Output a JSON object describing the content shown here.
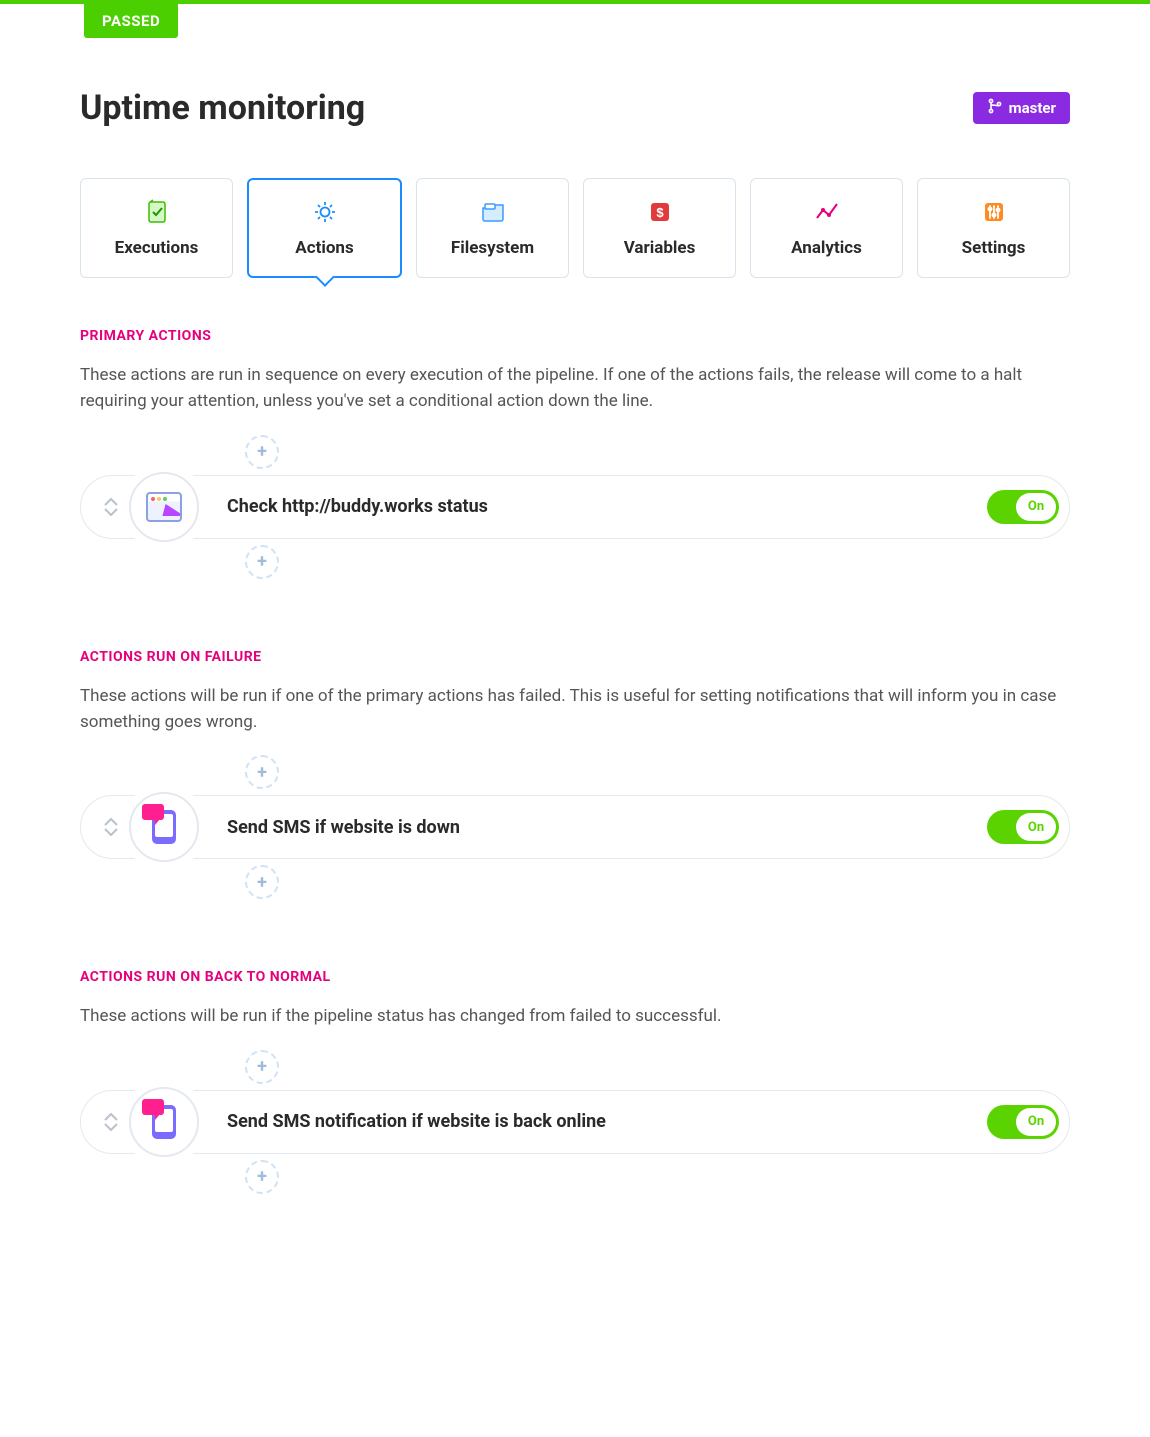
{
  "status_badge": "PASSED",
  "page_title": "Uptime monitoring",
  "branch_label": "master",
  "tabs": [
    {
      "label": "Executions"
    },
    {
      "label": "Actions"
    },
    {
      "label": "Filesystem"
    },
    {
      "label": "Variables"
    },
    {
      "label": "Analytics"
    },
    {
      "label": "Settings"
    }
  ],
  "active_tab_index": 1,
  "sections": {
    "primary": {
      "heading": "PRIMARY ACTIONS",
      "desc": "These actions are run in sequence on every execution of the pipeline. If one of the actions fails, the release will come to a halt requiring your attention, unless you've set a conditional action down the line.",
      "action": {
        "title": "Check http://buddy.works status",
        "toggle": "On"
      }
    },
    "failure": {
      "heading": "ACTIONS RUN ON FAILURE",
      "desc": "These actions will be run if one of the primary actions has failed. This is useful for setting notifications that will inform you in case something goes wrong.",
      "action": {
        "title": "Send SMS if website is down",
        "toggle": "On"
      }
    },
    "backnormal": {
      "heading": "ACTIONS RUN ON BACK TO NORMAL",
      "desc": "These actions will be run if the pipeline status has changed from failed to successful.",
      "action": {
        "title": "Send SMS notification if website is back online",
        "toggle": "On"
      }
    }
  }
}
